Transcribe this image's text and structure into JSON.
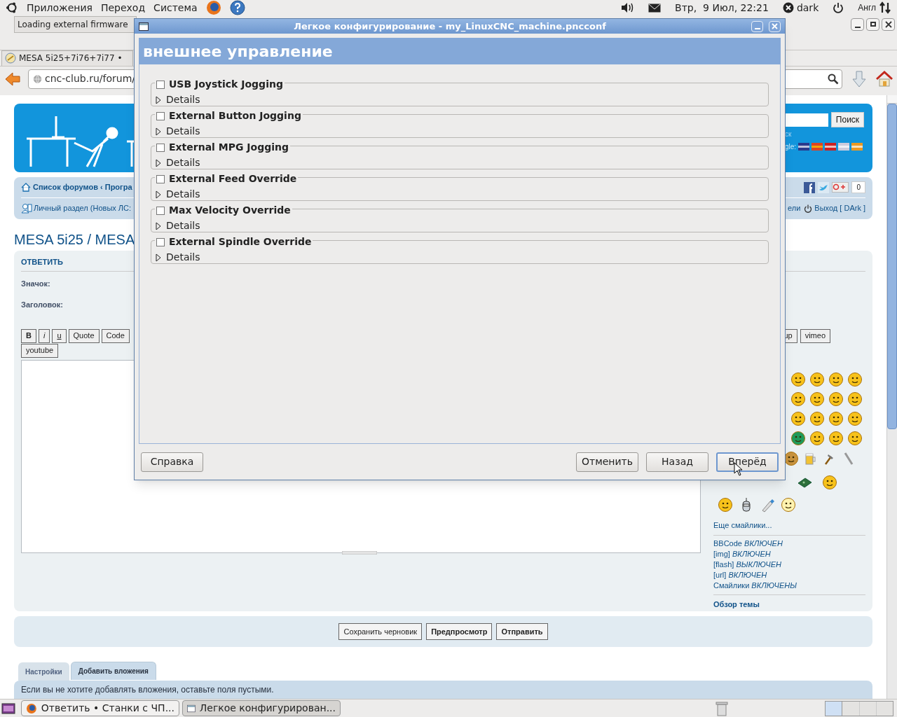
{
  "top_panel": {
    "menus": [
      "Приложения",
      "Переход",
      "Система"
    ],
    "clock": "Втр,  9 Июл, 22:21",
    "user": "dark",
    "keyboard_layout": "Англ"
  },
  "browser": {
    "notification": "Loading external firmware",
    "tab": "MESA 5i25+7i76+7i77 •",
    "url": "cnc-club.ru/forum/",
    "page": {
      "header": {
        "search_button": "Поиск",
        "search_link": "ск",
        "translate_label": "gle:"
      },
      "nav": {
        "breadcrumb": "Список форумов ‹ Програ",
        "personal": "Личный раздел (Новых ЛС:",
        "like_count": "0",
        "users_link": "ели",
        "logout": "Выход [ DArk ]"
      },
      "title": "MESA 5i25 / MESA",
      "reply": {
        "heading": "ОТВЕТИТЬ",
        "icon_label": "Значок:",
        "subject_label": "Заголовок:",
        "toolbar_left": [
          {
            "label": "B",
            "kind": "bold"
          },
          {
            "label": "i",
            "kind": "italic"
          },
          {
            "label": "u",
            "kind": "underline"
          },
          {
            "label": "Quote",
            "kind": "plain"
          },
          {
            "label": "Code",
            "kind": "plain"
          }
        ],
        "toolbar_right": [
          "up",
          "vimeo"
        ],
        "toolbar_row2": [
          "youtube"
        ],
        "more_smilies": "Еще смайлики...",
        "statuses": [
          {
            "name": "BBCode",
            "state": "ВКЛЮЧЕН"
          },
          {
            "name": "[img]",
            "state": "ВКЛЮЧЕН"
          },
          {
            "name": "[flash]",
            "state": "ВЫКЛЮЧЕН"
          },
          {
            "name": "[url]",
            "state": "ВКЛЮЧЕН"
          },
          {
            "name": "Смайлики",
            "state": "ВКЛЮЧЕНЫ"
          }
        ],
        "topic_review": "Обзор темы"
      },
      "actions": [
        {
          "label": "Сохранить черновик",
          "primary": false
        },
        {
          "label": "Предпросмотр",
          "primary": true
        },
        {
          "label": "Отправить",
          "primary": true
        }
      ],
      "tabs": [
        {
          "label": "Настройки",
          "selected": false
        },
        {
          "label": "Добавить вложения",
          "selected": true
        }
      ],
      "attachments_hint": "Если вы не хотите добавлять вложения, оставьте поля пустыми."
    }
  },
  "dialog": {
    "title": "Легкое конфигурирование - my_LinuxCNC_machine.pncconf",
    "heading": "внешнее управление",
    "options": [
      {
        "label": "USB Joystick Jogging",
        "checked": false,
        "expander": "Details",
        "expanded": false
      },
      {
        "label": "External Button Jogging",
        "checked": false,
        "expander": "Details",
        "expanded": false
      },
      {
        "label": "External MPG Jogging",
        "checked": false,
        "expander": "Details",
        "expanded": false
      },
      {
        "label": "External Feed Override",
        "checked": false,
        "expander": "Details",
        "expanded": false
      },
      {
        "label": "Max Velocity Override",
        "checked": false,
        "expander": "Details",
        "expanded": false
      },
      {
        "label": "External Spindle Override",
        "checked": false,
        "expander": "Details",
        "expanded": false
      }
    ],
    "buttons": [
      {
        "label": "Справка",
        "focused": false
      },
      {
        "label": "Отменить",
        "focused": false
      },
      {
        "label": "Назад",
        "focused": false
      },
      {
        "label": "Вперёд",
        "focused": true
      }
    ]
  },
  "taskbar": {
    "tasks": [
      {
        "label": "Ответить • Станки с ЧП...",
        "active": false
      },
      {
        "label": "Легкое конфигурирован...",
        "active": true
      }
    ]
  }
}
